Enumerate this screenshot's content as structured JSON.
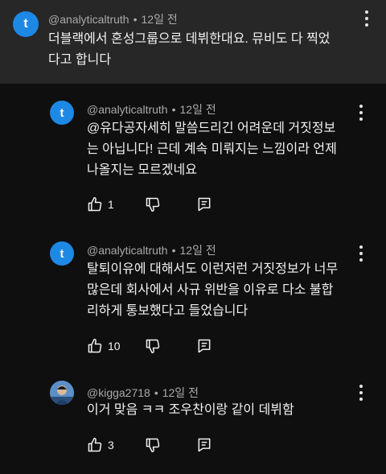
{
  "comments": [
    {
      "avatar_letter": "t",
      "author": "@analyticaltruth",
      "separator": "•",
      "time": "12일 전",
      "text": "더블랙에서 혼성그룹으로 데뷔한대요. 뮤비도 다 찍었\n다고 합니다",
      "highlighted": true
    },
    {
      "avatar_letter": "t",
      "author": "@analyticaltruth",
      "separator": "•",
      "time": "12일 전",
      "text": "@유다공자세히 말씀드리긴 어려운데 거짓정보\n는 아닙니다! 근데 계속 미뤄지는 느낌이라 언제\n나올지는 모르겠네요",
      "likes": "1"
    },
    {
      "avatar_letter": "t",
      "author": "@analyticaltruth",
      "separator": "•",
      "time": "12일 전",
      "text": "탈퇴이유에 대해서도 이런저런 거짓정보가 너무\n많은데 회사에서 사규 위반을 이유로 다소 불합\n리하게 통보했다고 들었습니다",
      "likes": "10"
    },
    {
      "author": "@kigga2718",
      "separator": "•",
      "time": "12일 전",
      "text": "이거 맞음 ㅋㅋ 조우찬이랑 같이 데뷔함",
      "likes": "3"
    }
  ],
  "icons": {
    "more": "kebab-menu-icon",
    "like": "thumbs-up-icon",
    "dislike": "thumbs-down-icon",
    "reply": "reply-icon"
  },
  "colors": {
    "background": "#0f0f0f",
    "highlight": "#272727",
    "avatar": "#1e88e5",
    "secondary_text": "#aaaaaa"
  }
}
